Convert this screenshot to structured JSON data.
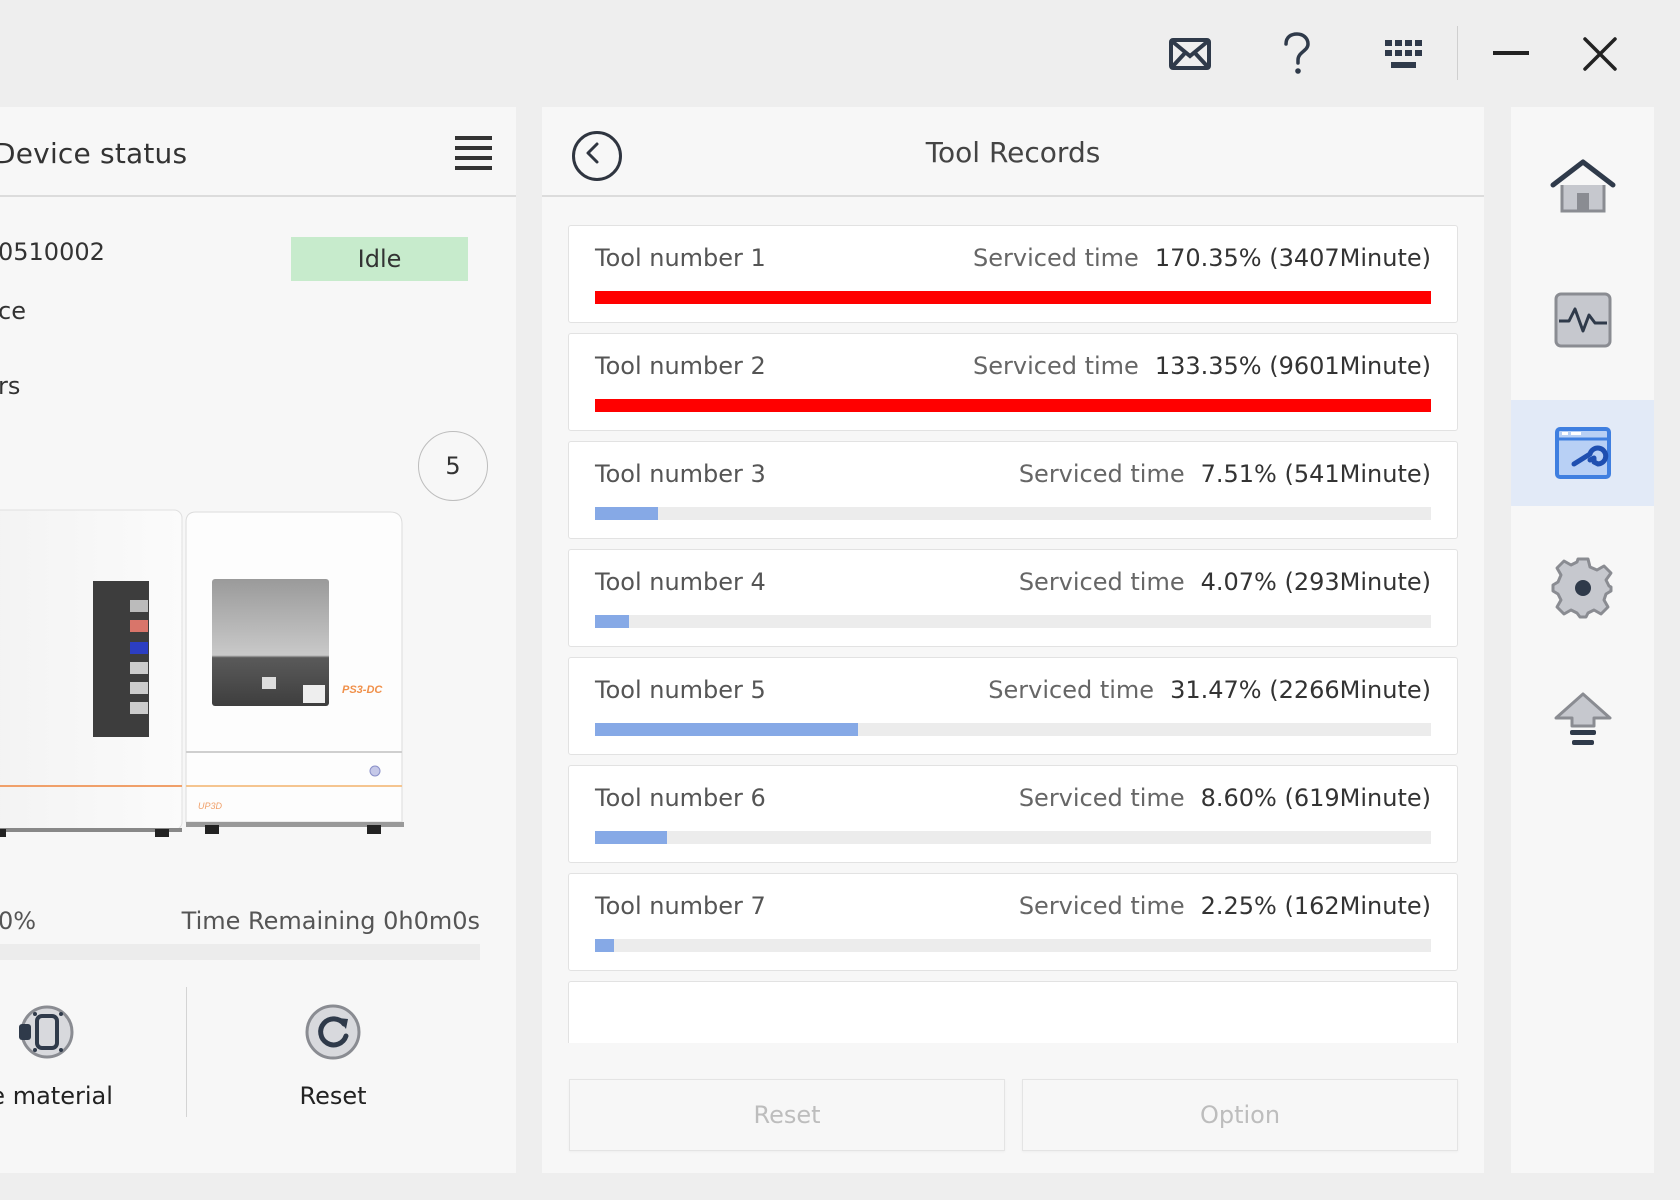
{
  "titlebar": {
    "icons": [
      "mail-icon",
      "help-icon",
      "keyboard-icon",
      "minimize-icon",
      "close-icon"
    ]
  },
  "device_panel": {
    "title": "Device status",
    "serial_fragment": "0510002",
    "status": "Idle",
    "status_color": "#c7ebcc",
    "line2_fragment": "ce",
    "line3_fragment": "rs",
    "queue_count": "5",
    "machine_model_label": "PS3-DC",
    "brand_label": "UP3D",
    "progress_text": "0%",
    "progress_fraction": 0,
    "time_remaining": "Time Remaining 0h0m0s",
    "actions": [
      {
        "label": "ce material",
        "icon": "material-icon"
      },
      {
        "label": "Reset",
        "icon": "reset-icon"
      }
    ]
  },
  "tool_records": {
    "title": "Tool Records",
    "serviced_label": "Serviced time",
    "over_color": "#ff0000",
    "normal_color": "#86a9e6",
    "tools": [
      {
        "name": "Tool number 1",
        "value": "170.35% (3407Minute)",
        "percent": 170.35
      },
      {
        "name": "Tool number 2",
        "value": "133.35% (9601Minute)",
        "percent": 133.35
      },
      {
        "name": "Tool number 3",
        "value": "7.51% (541Minute)",
        "percent": 7.51
      },
      {
        "name": "Tool number 4",
        "value": "4.07% (293Minute)",
        "percent": 4.07
      },
      {
        "name": "Tool number 5",
        "value": "31.47% (2266Minute)",
        "percent": 31.47
      },
      {
        "name": "Tool number 6",
        "value": "8.60% (619Minute)",
        "percent": 8.6
      },
      {
        "name": "Tool number 7",
        "value": "2.25% (162Minute)",
        "percent": 2.25
      }
    ],
    "buttons": {
      "reset": "Reset",
      "option": "Option"
    }
  },
  "nav": {
    "items": [
      {
        "name": "home",
        "active": false
      },
      {
        "name": "monitor",
        "active": false
      },
      {
        "name": "tool-maintenance",
        "active": true
      },
      {
        "name": "settings",
        "active": false
      },
      {
        "name": "upgrade",
        "active": false
      }
    ],
    "active_color": "#e2eaf7",
    "active_icon_color": "#3f7fe0"
  }
}
